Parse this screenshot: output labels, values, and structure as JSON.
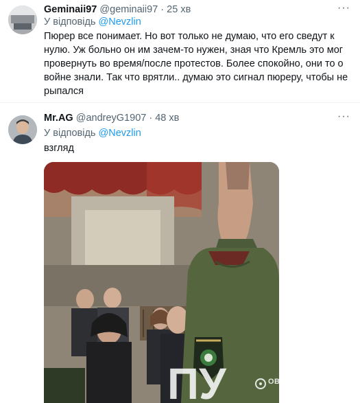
{
  "tweets": [
    {
      "display_name": "Geminaii97",
      "handle": "@geminaii97",
      "dot": "·",
      "time": "25 хв",
      "reply_prefix": "У відповідь",
      "reply_to": "@Nevzlin",
      "text": "Пюрер все понимает. Но вот только не думаю, что его сведут к нулю. Уж больно он им зачем-то нужен, зная что Кремль это мог провернуть во время/после протестов. Более спокойно, они то о войне знали. Так что врятли.. думаю это сигнал пюреру, чтобы не рыпался",
      "more_icon": "more-icon"
    },
    {
      "display_name": "Mr.AG",
      "handle": "@andreyG1907",
      "dot": "·",
      "time": "48 хв",
      "reply_prefix": "У відповідь",
      "reply_to": "@Nevzlin",
      "text": "взгляд",
      "more_icon": "more-icon"
    }
  ],
  "media": {
    "watermark": "OBOZREVATEL",
    "overlay_text": "ПУ"
  },
  "colors": {
    "link": "#1d9bf0",
    "secondary": "#536471",
    "text": "#0f1419",
    "divider": "#eff3f4"
  }
}
